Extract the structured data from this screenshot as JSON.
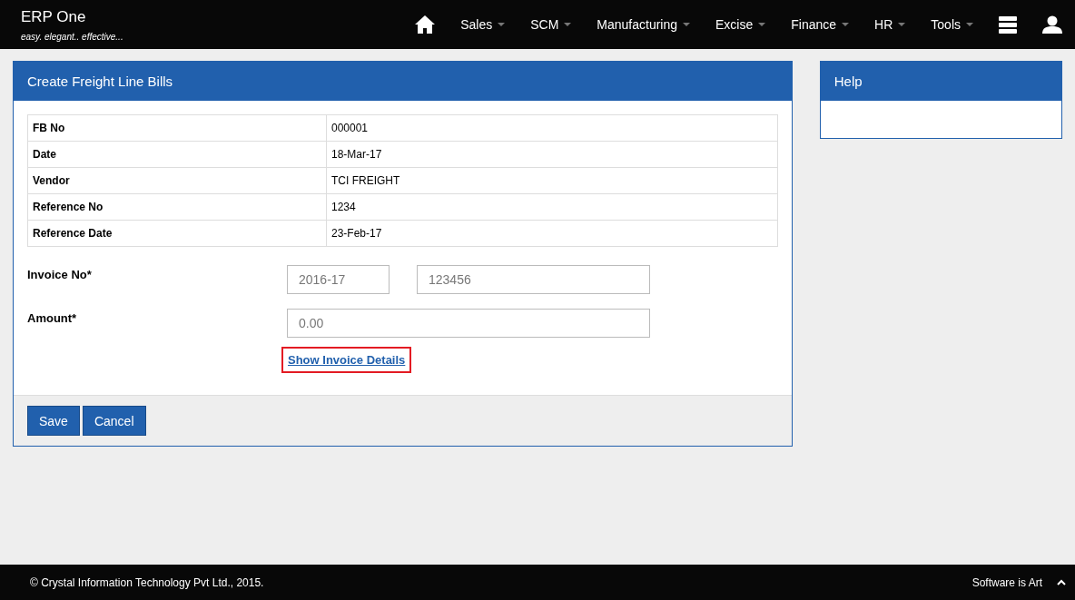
{
  "brand": {
    "title": "ERP One",
    "tagline": "easy. elegant.. effective..."
  },
  "nav": [
    {
      "label": "Sales"
    },
    {
      "label": "SCM"
    },
    {
      "label": "Manufacturing"
    },
    {
      "label": "Excise"
    },
    {
      "label": "Finance"
    },
    {
      "label": "HR"
    },
    {
      "label": "Tools"
    }
  ],
  "panel": {
    "title": "Create Freight Line Bills",
    "details": [
      {
        "label": "FB No",
        "value": "000001"
      },
      {
        "label": "Date",
        "value": "18-Mar-17"
      },
      {
        "label": "Vendor",
        "value": "TCI FREIGHT"
      },
      {
        "label": "Reference No",
        "value": "1234"
      },
      {
        "label": "Reference Date",
        "value": "23-Feb-17"
      }
    ],
    "invoice": {
      "label": "Invoice No*",
      "year": "2016-17",
      "number": "123456"
    },
    "amount": {
      "label": "Amount*",
      "value": "0.00"
    },
    "link": {
      "label": "Show Invoice Details",
      "focused": true
    },
    "buttons": [
      "Save",
      "Cancel"
    ]
  },
  "help": {
    "title": "Help"
  },
  "footer": {
    "copyright": "© Crystal Information Technology Pvt Ltd., 2015.",
    "slogan": "Software is Art"
  }
}
